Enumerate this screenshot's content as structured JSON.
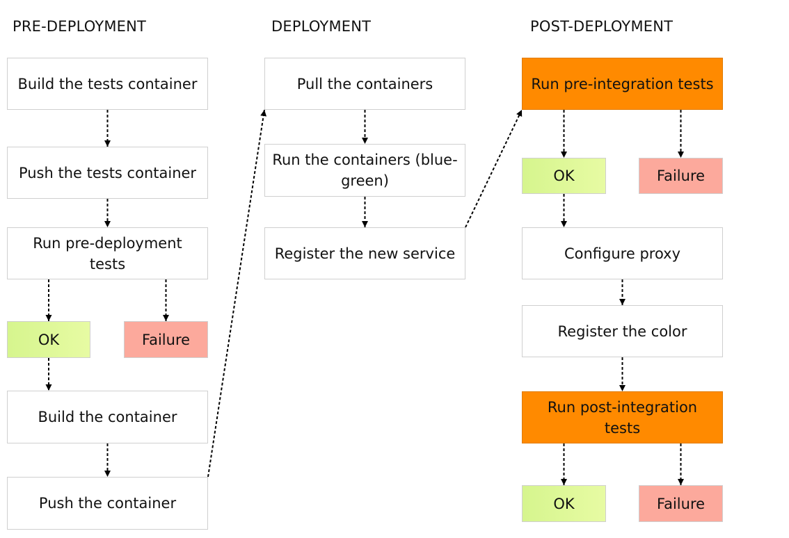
{
  "columns": [
    {
      "heading": "PRE-DEPLOYMENT"
    },
    {
      "heading": "DEPLOYMENT"
    },
    {
      "heading": "POST-DEPLOYMENT"
    }
  ],
  "nodes": {
    "build_tests": {
      "label": "Build the tests container",
      "kind": "step"
    },
    "push_tests": {
      "label": "Push the tests container",
      "kind": "step"
    },
    "run_predeploy": {
      "label": "Run pre-deployment tests",
      "kind": "step"
    },
    "pre_ok": {
      "label": "OK",
      "kind": "ok"
    },
    "pre_fail": {
      "label": "Failure",
      "kind": "failure"
    },
    "build_container": {
      "label": "Build the container",
      "kind": "step"
    },
    "push_container": {
      "label": "Push the container",
      "kind": "step"
    },
    "pull_containers": {
      "label": "Pull the containers",
      "kind": "step"
    },
    "run_containers": {
      "label": "Run the containers (blue-green)",
      "kind": "step"
    },
    "register_service": {
      "label": "Register the new service",
      "kind": "step"
    },
    "run_preint": {
      "label": "Run pre-integration tests",
      "kind": "test"
    },
    "preint_ok": {
      "label": "OK",
      "kind": "ok"
    },
    "preint_fail": {
      "label": "Failure",
      "kind": "failure"
    },
    "configure_proxy": {
      "label": "Configure proxy",
      "kind": "step"
    },
    "register_color": {
      "label": "Register the color",
      "kind": "step"
    },
    "run_postint": {
      "label": "Run post-integration tests",
      "kind": "test"
    },
    "postint_ok": {
      "label": "OK",
      "kind": "ok"
    },
    "postint_fail": {
      "label": "Failure",
      "kind": "failure"
    }
  },
  "edges": [
    {
      "from": "build_tests",
      "to": "push_tests"
    },
    {
      "from": "push_tests",
      "to": "run_predeploy"
    },
    {
      "from": "run_predeploy",
      "to": "pre_ok"
    },
    {
      "from": "run_predeploy",
      "to": "pre_fail"
    },
    {
      "from": "pre_ok",
      "to": "build_container"
    },
    {
      "from": "build_container",
      "to": "push_container"
    },
    {
      "from": "push_container",
      "to": "pull_containers"
    },
    {
      "from": "pull_containers",
      "to": "run_containers"
    },
    {
      "from": "run_containers",
      "to": "register_service"
    },
    {
      "from": "register_service",
      "to": "run_preint"
    },
    {
      "from": "run_preint",
      "to": "preint_ok"
    },
    {
      "from": "run_preint",
      "to": "preint_fail"
    },
    {
      "from": "preint_ok",
      "to": "configure_proxy"
    },
    {
      "from": "configure_proxy",
      "to": "register_color"
    },
    {
      "from": "register_color",
      "to": "run_postint"
    },
    {
      "from": "run_postint",
      "to": "postint_ok"
    },
    {
      "from": "run_postint",
      "to": "postint_fail"
    }
  ],
  "colors": {
    "ok": "#dcf796",
    "failure": "#fca99c",
    "test": "#ff8a00",
    "border": "#cfcfcf"
  }
}
